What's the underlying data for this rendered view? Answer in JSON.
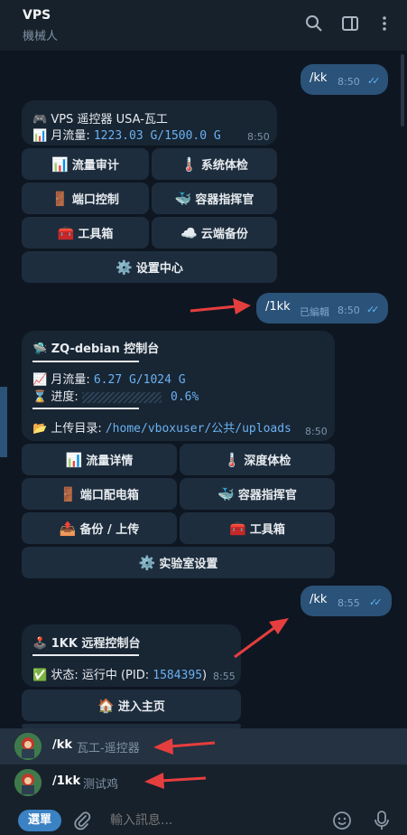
{
  "header": {
    "title": "VPS",
    "subtitle": "機械人",
    "icons": [
      "search-icon",
      "sidebar-icon",
      "more-icon"
    ]
  },
  "messages": {
    "m1": {
      "text": "/kk",
      "time": "8:50"
    },
    "m2": {
      "line1_icon": "🎮",
      "line1": "VPS 遥控器 USA-瓦工",
      "line2_icon": "📊",
      "line2_label": "月流量:",
      "line2_value": "1223.03 G/1500.0 G",
      "time": "8:50",
      "buttons": [
        {
          "icon": "📊",
          "label": "流量审计"
        },
        {
          "icon": "🌡️",
          "label": "系统体检"
        },
        {
          "icon": "🚪",
          "label": "端口控制"
        },
        {
          "icon": "🐳",
          "label": "容器指挥官"
        },
        {
          "icon": "🧰",
          "label": "工具箱"
        },
        {
          "icon": "☁️",
          "label": "云端备份"
        },
        {
          "icon": "⚙️",
          "label": "设置中心"
        }
      ]
    },
    "m3": {
      "text": "/1kk",
      "edited": "已編輯",
      "time": "8:50"
    },
    "m4": {
      "title_icon": "🛸",
      "title": "ZQ-debian 控制台",
      "traffic_icon": "📈",
      "traffic_label": "月流量:",
      "traffic_value": "6.27 G/1024 G",
      "progress_icon": "⌛",
      "progress_label": "进度:",
      "progress_value": "0.6%",
      "progress_fraction": 0.006,
      "upload_icon": "📂",
      "upload_label": "上传目录:",
      "upload_path": "/home/vboxuser/公共/uploads",
      "time": "8:50",
      "buttons": [
        {
          "icon": "📊",
          "label": "流量详情"
        },
        {
          "icon": "🌡️",
          "label": "深度体检"
        },
        {
          "icon": "🚪",
          "label": "端口配电箱"
        },
        {
          "icon": "🐳",
          "label": "容器指挥官"
        },
        {
          "icon": "📤",
          "label": "备份 / 上传"
        },
        {
          "icon": "🧰",
          "label": "工具箱"
        },
        {
          "icon": "⚙️",
          "label": "实验室设置"
        }
      ]
    },
    "m5": {
      "text": "/kk",
      "time": "8:55"
    },
    "m6": {
      "title_icon": "🕹️",
      "title": "1KK 远程控制台",
      "status_icon": "✅",
      "status_label": "状态: 运行中 (PID: ",
      "pid": "1584395",
      "status_end": ")",
      "time": "8:55",
      "buttons": [
        {
          "icon": "🏠",
          "label": "进入主页"
        }
      ]
    }
  },
  "suggestions": [
    {
      "command": "/kk",
      "description": "瓦工-遥控器"
    },
    {
      "command": "/1kk",
      "description": "测试鸡"
    }
  ],
  "composer": {
    "menu_label": "選單",
    "placeholder": "輸入訊息..."
  },
  "colors": {
    "background": "#0e1621",
    "bubble_out": "#2b5278",
    "bubble_in": "#182533",
    "arrow": "#e53e3e"
  }
}
